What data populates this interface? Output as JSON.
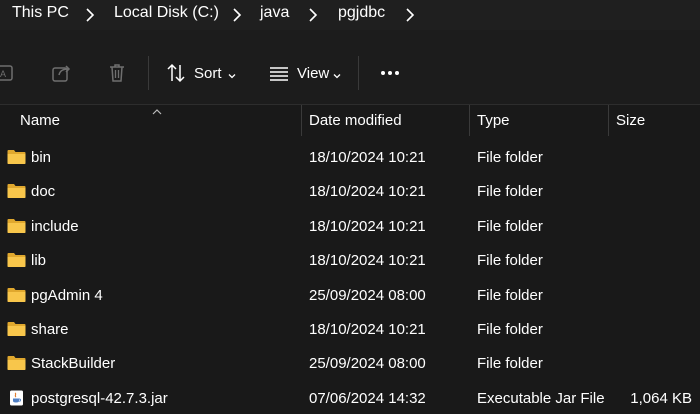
{
  "breadcrumb": {
    "items": [
      "This PC",
      "Local Disk (C:)",
      "java",
      "pgjdbc"
    ]
  },
  "toolbar": {
    "sort_label": "Sort",
    "view_label": "View"
  },
  "columns": {
    "name": "Name",
    "date": "Date modified",
    "type": "Type",
    "size": "Size"
  },
  "files": [
    {
      "name": "bin",
      "date": "18/10/2024 10:21",
      "type": "File folder",
      "size": "",
      "icon": "folder-icon"
    },
    {
      "name": "doc",
      "date": "18/10/2024 10:21",
      "type": "File folder",
      "size": "",
      "icon": "folder-icon"
    },
    {
      "name": "include",
      "date": "18/10/2024 10:21",
      "type": "File folder",
      "size": "",
      "icon": "folder-icon"
    },
    {
      "name": "lib",
      "date": "18/10/2024 10:21",
      "type": "File folder",
      "size": "",
      "icon": "folder-icon"
    },
    {
      "name": "pgAdmin 4",
      "date": "25/09/2024 08:00",
      "type": "File folder",
      "size": "",
      "icon": "folder-icon"
    },
    {
      "name": "share",
      "date": "18/10/2024 10:21",
      "type": "File folder",
      "size": "",
      "icon": "folder-icon"
    },
    {
      "name": "StackBuilder",
      "date": "25/09/2024 08:00",
      "type": "File folder",
      "size": "",
      "icon": "folder-icon"
    },
    {
      "name": "postgresql-42.7.3.jar",
      "date": "07/06/2024 14:32",
      "type": "Executable Jar File",
      "size": "1,064 KB",
      "icon": "java-jar-icon"
    }
  ],
  "colors": {
    "background": "#191919",
    "folder": "#f8c64b",
    "folder_dark": "#e0a82e"
  }
}
